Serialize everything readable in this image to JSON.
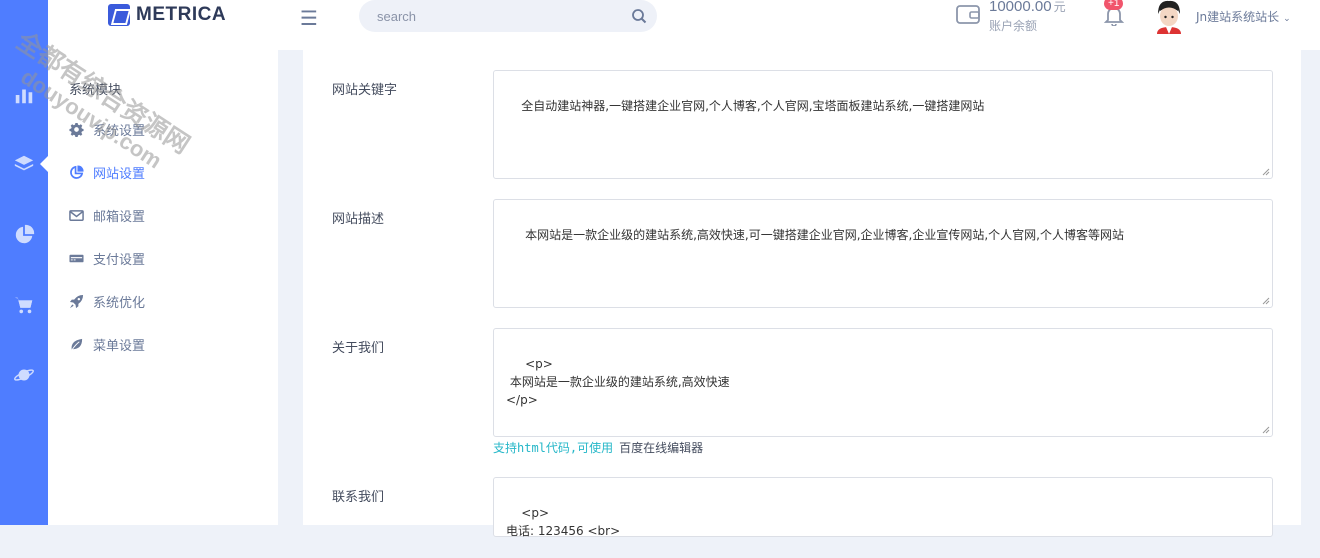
{
  "header": {
    "logo_text": "METRICA",
    "menu_glyph": "☰",
    "search_placeholder": "search",
    "balance_amount": "10000.00",
    "balance_unit": "元",
    "balance_label": "账户余额",
    "notification_badge": "+1",
    "user_name": "Jn建站系统站长",
    "user_chevron": "⌄"
  },
  "rail": {
    "icons": [
      "chart-icon",
      "layers-icon",
      "pie-chart-icon",
      "cart-icon",
      "planet-icon"
    ],
    "accent_color": "#4f7dff"
  },
  "sidebar": {
    "title": "系统模块",
    "items": [
      {
        "label": "系统设置",
        "icon": "gear-icon",
        "active": false
      },
      {
        "label": "网站设置",
        "icon": "pie-icon",
        "active": true
      },
      {
        "label": "邮箱设置",
        "icon": "mail-icon",
        "active": false
      },
      {
        "label": "支付设置",
        "icon": "card-icon",
        "active": false
      },
      {
        "label": "系统优化",
        "icon": "rocket-icon",
        "active": false
      },
      {
        "label": "菜单设置",
        "icon": "leaf-icon",
        "active": false
      }
    ]
  },
  "form": {
    "keywords_label": "网站关键字",
    "keywords_value": "全自动建站神器,一键搭建企业官网,个人博客,个人官网,宝塔面板建站系统,一键搭建网站",
    "description_label": "网站描述",
    "description_value": " 本网站是一款企业级的建站系统,高效快速,可一键搭建企业官网,企业博客,企业宣传网站,个人官网,个人博客等网站",
    "about_label": "关于我们",
    "about_value": " <p>\n 本网站是一款企业级的建站系统,高效快速\n</p>",
    "about_hint_code": "支持html代码,可使用",
    "about_hint_link": "百度在线编辑器",
    "contact_label": "联系我们",
    "contact_value": "<p>\n电话: 123456 <br>"
  },
  "watermark": {
    "line1": "全都有综合资源网",
    "line2": "douyouvip.com"
  }
}
